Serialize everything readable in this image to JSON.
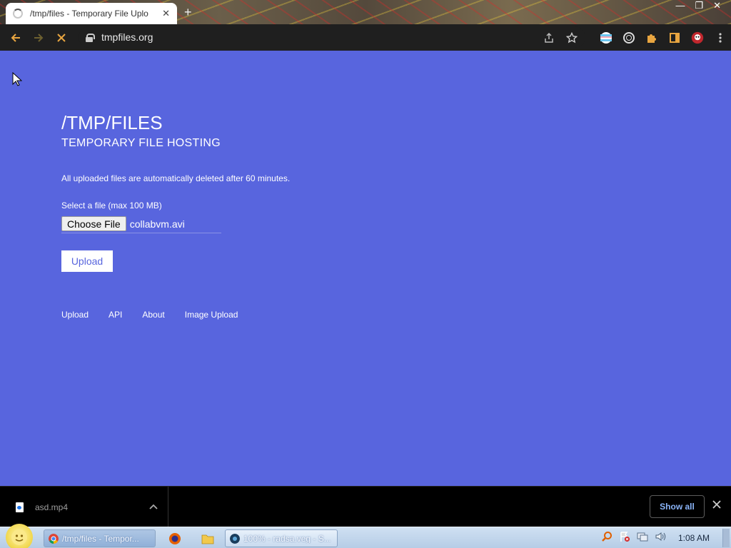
{
  "browser": {
    "tab_title": "/tmp/files - Temporary File Uplo",
    "tab_close": "✕",
    "new_tab": "+",
    "window_controls": {
      "minimize": "—",
      "restore": "❐",
      "close": "✕"
    },
    "url": "tmpfiles.org"
  },
  "page": {
    "title": "/TMP/FILES",
    "subtitle": "TEMPORARY FILE HOSTING",
    "notice": "All uploaded files are automatically deleted after 60 minutes.",
    "file_label": "Select a file (max 100 MB)",
    "choose_file_label": "Choose File",
    "file_name": "collabvm.avi",
    "upload_label": "Upload",
    "footer_links": [
      "Upload",
      "API",
      "About",
      "Image Upload"
    ],
    "background_color": "#5865de"
  },
  "download_shelf": {
    "file_name": "asd.mp4",
    "show_all_label": "Show all"
  },
  "taskbar": {
    "chrome_task": "/tmp/files - Tempor...",
    "veg_task": "100% - radsa.veg - S...",
    "clock": "1:08 AM"
  }
}
